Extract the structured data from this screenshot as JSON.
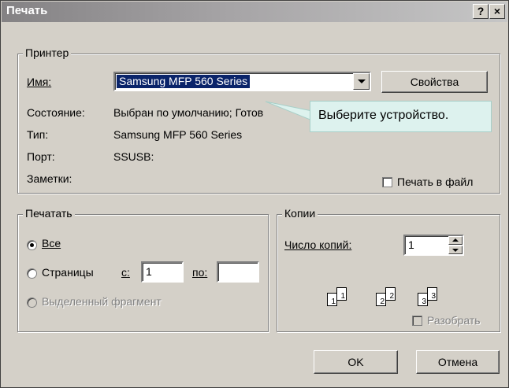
{
  "window": {
    "title": "Печать",
    "help_glyph": "?",
    "close_glyph": "×"
  },
  "printer": {
    "legend": "Принтер",
    "name_label": "Имя:",
    "name_value": "Samsung MFP 560 Series",
    "properties_button": "Свойства",
    "status_label": "Состояние:",
    "status_value": "Выбран по умолчанию; Готов",
    "type_label": "Тип:",
    "type_value": "Samsung MFP 560 Series",
    "port_label": "Порт:",
    "port_value": "SSUSB:",
    "notes_label": "Заметки:",
    "print_to_file": "Печать в файл"
  },
  "callout": {
    "text": "Выберите устройство."
  },
  "range": {
    "legend": "Печатать",
    "all": "Все",
    "pages": "Страницы",
    "from_label": "с:",
    "from_value": "1",
    "to_label": "по:",
    "to_value": "",
    "selection": "Выделенный фрагмент"
  },
  "copies": {
    "legend": "Копии",
    "count_label": "Число копий:",
    "count_value": "1",
    "collate": "Разобрать",
    "page_numbers": [
      "1",
      "1",
      "2",
      "2",
      "3",
      "3"
    ]
  },
  "buttons": {
    "ok": "OK",
    "cancel": "Отмена"
  }
}
